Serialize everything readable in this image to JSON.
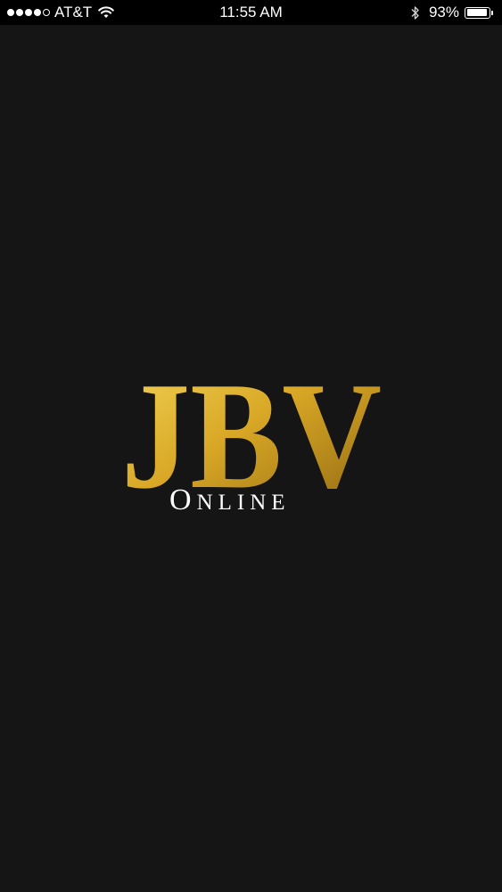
{
  "status_bar": {
    "signal_bars_filled": 4,
    "signal_bars_total": 5,
    "carrier": "AT&T",
    "time": "11:55 AM",
    "battery_percent": "93%",
    "battery_level": 0.93,
    "icons": [
      "signal-icon",
      "wifi-icon",
      "bluetooth-icon",
      "battery-icon"
    ]
  },
  "splash": {
    "logo_text": "JBV",
    "logo_subtitle_initial": "O",
    "logo_subtitle_rest": "NLINE",
    "colors": {
      "background": "#151515",
      "gold_light": "#f3d55a",
      "gold_mid": "#d9a826",
      "gold_dark": "#8c6510",
      "subtitle": "#ffffff"
    }
  }
}
